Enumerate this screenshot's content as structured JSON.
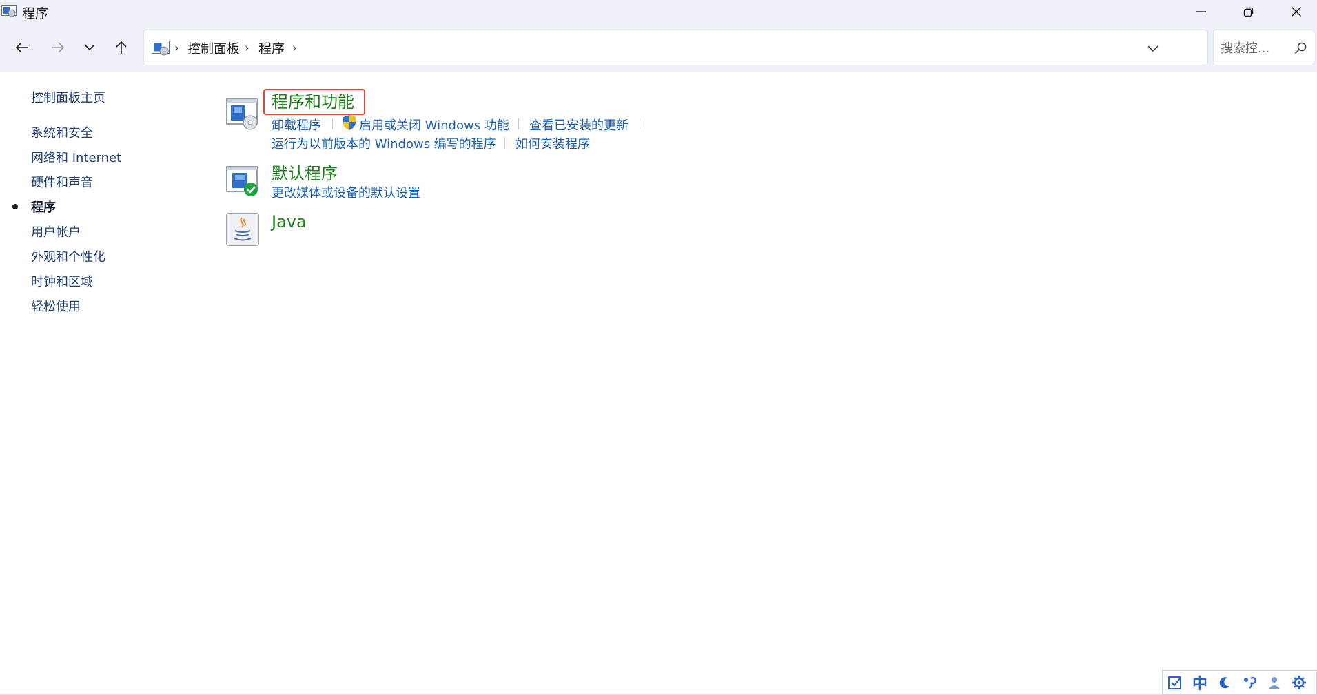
{
  "window": {
    "title": "程序",
    "app_icon": "control-panel-icon",
    "buttons": [
      "minimize-icon",
      "restore-icon",
      "close-icon"
    ]
  },
  "navigation": {
    "back_icon": "arrow-left-icon",
    "forward_icon": "arrow-right-icon",
    "recent_icon": "chevron-down-icon",
    "up_icon": "arrow-up-icon",
    "breadcrumbs": [
      "控制面板",
      "程序"
    ],
    "dropdown_icon": "chevron-down-icon",
    "refresh_icon": "refresh-icon",
    "search_placeholder": "搜索控..."
  },
  "sidebar": {
    "home": "控制面板主页",
    "items": [
      {
        "label": "系统和安全",
        "active": false
      },
      {
        "label": "网络和 Internet",
        "active": false
      },
      {
        "label": "硬件和声音",
        "active": false
      },
      {
        "label": "程序",
        "active": true
      },
      {
        "label": "用户帐户",
        "active": false
      },
      {
        "label": "外观和个性化",
        "active": false
      },
      {
        "label": "时钟和区域",
        "active": false
      },
      {
        "label": "轻松使用",
        "active": false
      }
    ]
  },
  "categories": [
    {
      "title": "程序和功能",
      "icon": "programs-features-icon",
      "highlighted": true,
      "links": [
        "卸载程序",
        "启用或关闭 Windows 功能",
        "查看已安装的更新",
        "运行为以前版本的 Windows 编写的程序",
        "如何安装程序"
      ]
    },
    {
      "title": "默认程序",
      "icon": "default-programs-icon",
      "links": [
        "更改媒体或设备的默认设置"
      ]
    },
    {
      "title": "Java",
      "icon": "java-icon",
      "links": []
    }
  ],
  "ime_bar": {
    "items": [
      "ime-toolbox-icon",
      "中",
      "moon-icon",
      "punctuation-icon",
      "user-icon",
      "gear-icon"
    ]
  },
  "colors": {
    "chrome_background": "#eef1f8",
    "category_title": "#1a7f18",
    "link": "#1a5fb4",
    "highlight_box": "#e0443a"
  }
}
